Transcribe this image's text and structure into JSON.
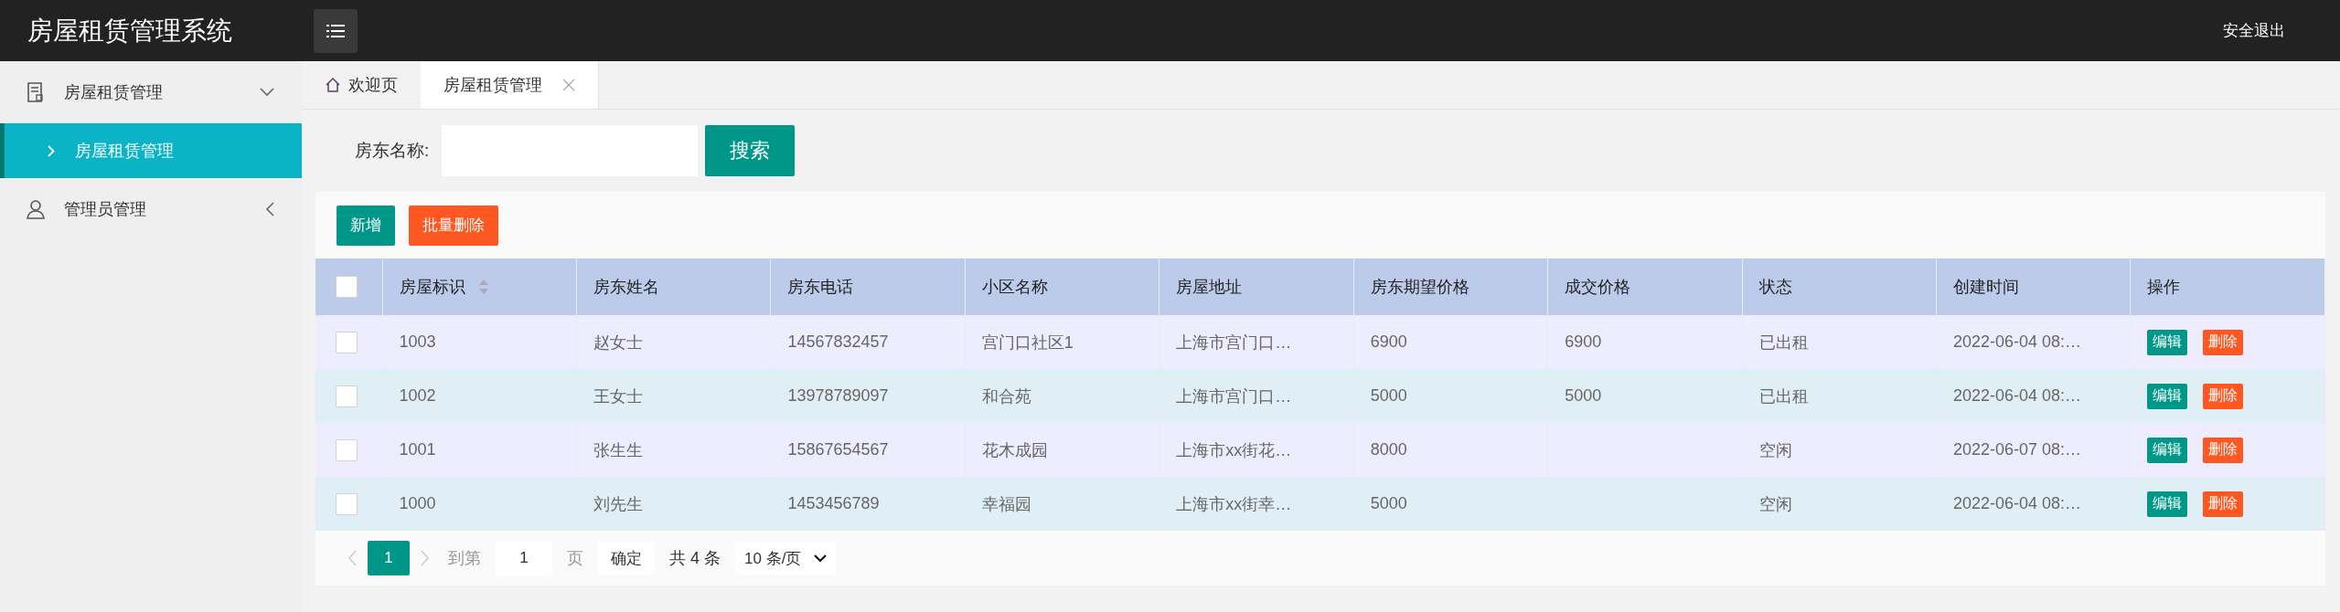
{
  "header": {
    "title": "房屋租赁管理系统",
    "logout": "安全退出"
  },
  "sidebar": {
    "items": [
      {
        "label": "房屋租赁管理",
        "expanded": true,
        "children": [
          {
            "label": "房屋租赁管理",
            "selected": true
          }
        ]
      },
      {
        "label": "管理员管理",
        "expanded": false
      }
    ]
  },
  "tabs": [
    {
      "label": "欢迎页",
      "selected": false,
      "closable": false
    },
    {
      "label": "房屋租赁管理",
      "selected": true,
      "closable": true
    }
  ],
  "search": {
    "label": "房东名称:",
    "button": "搜索"
  },
  "toolbar": {
    "add": "新增",
    "batch_delete": "批量删除"
  },
  "table": {
    "header_checked": false,
    "columns": [
      "房屋标识",
      "房东姓名",
      "房东电话",
      "小区名称",
      "房屋地址",
      "房东期望价格",
      "成交价格",
      "状态",
      "创建时间",
      "操作"
    ],
    "rows": [
      {
        "checked": false,
        "cells": [
          "1003",
          "赵女士",
          "14567832457",
          "宫门口社区1",
          "上海市宫门口…",
          "6900",
          "6900",
          "已出租",
          "2022-06-04 08:…"
        ],
        "edit": "编辑",
        "delete": "删除"
      },
      {
        "checked": false,
        "cells": [
          "1002",
          "王女士",
          "13978789097",
          "和合苑",
          "上海市宫门口…",
          "5000",
          "5000",
          "已出租",
          "2022-06-04 08:…"
        ],
        "edit": "编辑",
        "delete": "删除"
      },
      {
        "checked": false,
        "cells": [
          "1001",
          "张生生",
          "15867654567",
          "花木成园",
          "上海市xx街花…",
          "8000",
          "",
          "空闲",
          "2022-06-07 08:…"
        ],
        "edit": "编辑",
        "delete": "删除"
      },
      {
        "checked": false,
        "cells": [
          "1000",
          "刘先生",
          "1453456789",
          "幸福园",
          "上海市xx街幸…",
          "5000",
          "",
          "空闲",
          "2022-06-04 08:…"
        ],
        "edit": "编辑",
        "delete": "删除"
      }
    ]
  },
  "pagination": {
    "pages": [
      {
        "label": "1",
        "selected": true
      }
    ],
    "goto_label": "到第",
    "goto_value": "1",
    "page_unit": "页",
    "confirm": "确定",
    "total": "共 4 条",
    "page_size": "10 条/页"
  }
}
